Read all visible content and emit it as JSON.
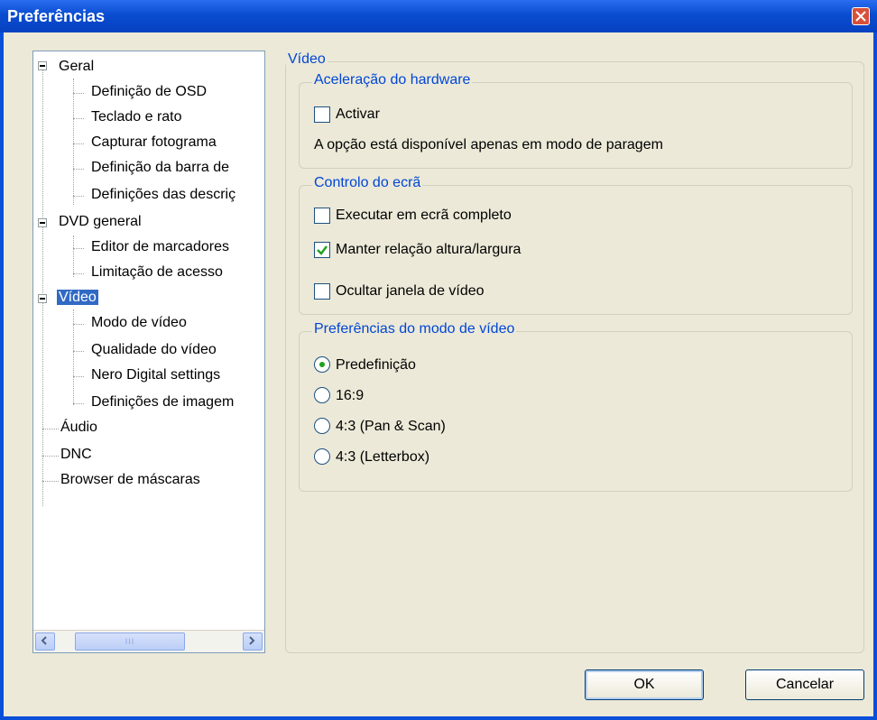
{
  "window": {
    "title": "Preferências"
  },
  "tree": {
    "items": [
      {
        "label": "Geral"
      },
      {
        "label": "Definição de OSD"
      },
      {
        "label": "Teclado e rato"
      },
      {
        "label": "Capturar fotograma"
      },
      {
        "label": "Definição da barra de"
      },
      {
        "label": "Definições das descriç"
      },
      {
        "label": "DVD general"
      },
      {
        "label": "Editor de marcadores"
      },
      {
        "label": "Limitação de acesso"
      },
      {
        "label": "Vídeo"
      },
      {
        "label": "Modo de vídeo"
      },
      {
        "label": "Qualidade do vídeo"
      },
      {
        "label": "Nero Digital settings"
      },
      {
        "label": "Definições de imagem"
      },
      {
        "label": "Áudio"
      },
      {
        "label": "DNC"
      },
      {
        "label": "Browser de máscaras"
      }
    ],
    "scroll_grip": "III"
  },
  "panel": {
    "title": "Vídeo",
    "hw": {
      "title": "Aceleração do hardware",
      "activate": "Activar",
      "activate_checked": false,
      "note": "A opção está disponível apenas em modo de paragem"
    },
    "screen": {
      "title": "Controlo do ecrã",
      "fullscreen": "Executar em ecrã completo",
      "fullscreen_checked": false,
      "aspect": "Manter relação altura/largura",
      "aspect_checked": true,
      "hide": "Ocultar janela de vídeo",
      "hide_checked": false
    },
    "mode": {
      "title": "Preferências do modo de vídeo",
      "options": [
        "Predefinição",
        "16:9",
        "4:3 (Pan & Scan)",
        "4:3 (Letterbox)"
      ],
      "selected": "Predefinição"
    }
  },
  "buttons": {
    "ok": "OK",
    "cancel": "Cancelar"
  },
  "colors": {
    "titlebar": "#0b4dd0",
    "group_title": "#0046d5",
    "selection": "#316ac5",
    "check": "#21a121"
  }
}
